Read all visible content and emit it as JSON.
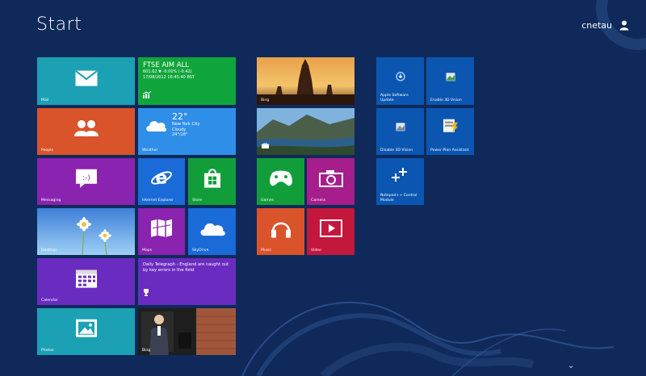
{
  "screen": {
    "title": "Start",
    "user": "cnetau"
  },
  "tiles": {
    "mail": {
      "label": "Mail",
      "color": "#1ba1b3"
    },
    "finance": {
      "label": "",
      "color": "#10a53b",
      "title": "FTSE AIM ALL",
      "line1": "601.62 ▼ -0.00% (-0.42)",
      "line2": "17/08/2012 16:45:40 BST"
    },
    "people": {
      "label": "People",
      "color": "#d9532b"
    },
    "weather": {
      "label": "Weather",
      "color": "#2f8ee8",
      "temp": "22°",
      "city": "New York City",
      "condition": "Cloudy",
      "range": "24°/18°"
    },
    "messaging": {
      "label": "Messaging",
      "color": "#8a23b0"
    },
    "ie": {
      "label": "Internet Explorer",
      "color": "#1a6ad8"
    },
    "store": {
      "label": "Store",
      "color": "#119e3a"
    },
    "desktop": {
      "label": "Desktop"
    },
    "maps": {
      "label": "Maps",
      "color": "#8a23b0"
    },
    "skydrive": {
      "label": "SkyDrive",
      "color": "#1a6ad8"
    },
    "calendar": {
      "label": "Calendar",
      "color": "#6a2cc0"
    },
    "news": {
      "label": "",
      "color": "#6a2cc0",
      "headline": "Daily Telegraph - England are caught out by key errors in the field"
    },
    "photos": {
      "label": "Photos",
      "color": "#1ba1b3"
    },
    "bing": {
      "label": "Bing"
    },
    "travel": {
      "label": ""
    },
    "games": {
      "label": "Games",
      "color": "#119e3a"
    },
    "camera": {
      "label": "Camera",
      "color": "#a51e8c"
    },
    "music": {
      "label": "Music",
      "color": "#d9532b"
    },
    "video": {
      "label": "Video",
      "color": "#c3173c"
    },
    "apple_update": {
      "label": "Apple Software Update",
      "color": "#0b56b1"
    },
    "enable_3d": {
      "label": "Enable 3D Vision",
      "color": "#0b56b1"
    },
    "disable_3d": {
      "label": "Disable 3D Vision",
      "color": "#0b56b1"
    },
    "power_plan": {
      "label": "Power Plan Assistant",
      "color": "#0b56b1"
    },
    "notepad": {
      "label": "Notepad++ Control Module",
      "color": "#0b56b1"
    }
  }
}
